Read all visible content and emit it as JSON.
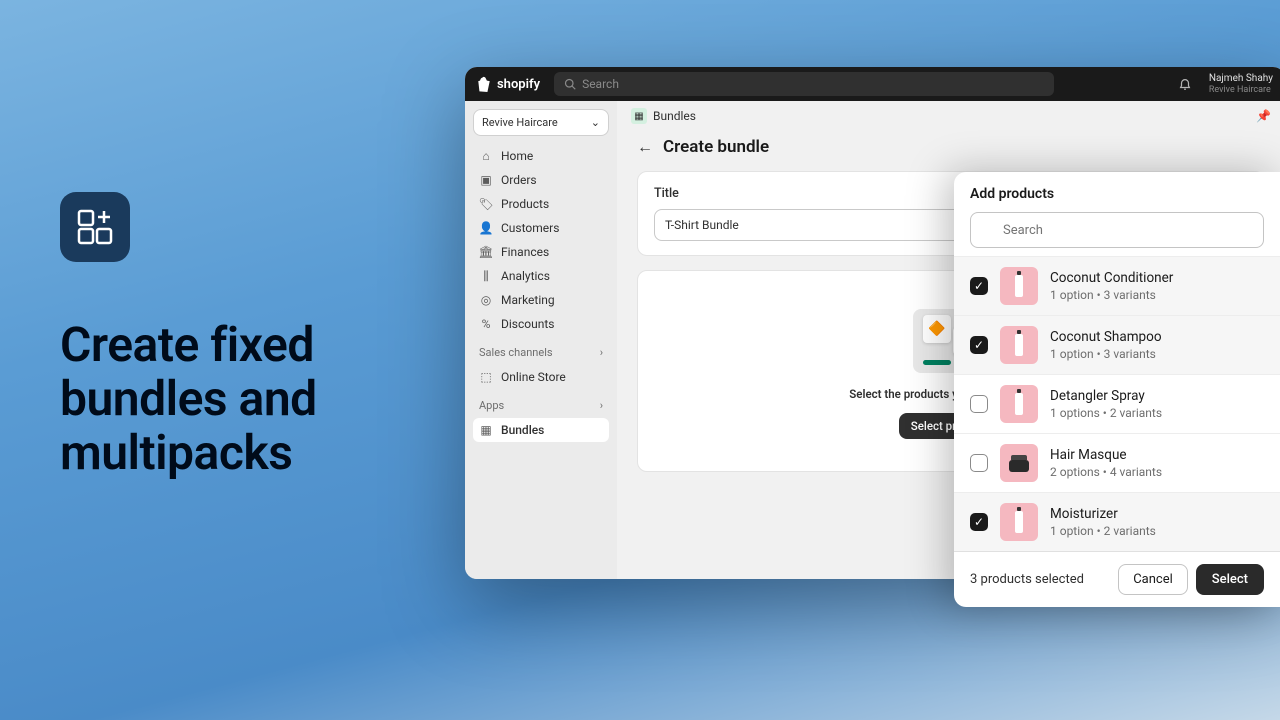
{
  "promo": {
    "headline_l1": "Create fixed",
    "headline_l2": "bundles and",
    "headline_l3": "multipacks"
  },
  "header": {
    "brand": "shopify",
    "search_placeholder": "Search",
    "user_name": "Najmeh Shahy",
    "user_store": "Revive Haircare"
  },
  "sidebar": {
    "store": "Revive Haircare",
    "nav": [
      {
        "icon": "home",
        "label": "Home"
      },
      {
        "icon": "orders",
        "label": "Orders"
      },
      {
        "icon": "products",
        "label": "Products"
      },
      {
        "icon": "customers",
        "label": "Customers"
      },
      {
        "icon": "finances",
        "label": "Finances"
      },
      {
        "icon": "analytics",
        "label": "Analytics"
      },
      {
        "icon": "marketing",
        "label": "Marketing"
      },
      {
        "icon": "discounts",
        "label": "Discounts"
      }
    ],
    "channels_label": "Sales channels",
    "channels": [
      {
        "label": "Online Store"
      }
    ],
    "apps_label": "Apps",
    "apps": [
      {
        "label": "Bundles"
      }
    ]
  },
  "crumb": {
    "label": "Bundles"
  },
  "page": {
    "title": "Create bundle",
    "title_field_label": "Title",
    "title_value": "T-Shirt Bundle",
    "empty_text": "Select the products you want to bundle.",
    "select_btn": "Select products"
  },
  "modal": {
    "title": "Add products",
    "search_placeholder": "Search",
    "products": [
      {
        "name": "Coconut Conditioner",
        "meta": "1 option • 3 variants",
        "checked": true,
        "thumb": "bottle"
      },
      {
        "name": "Coconut Shampoo",
        "meta": "1 option • 3 variants",
        "checked": true,
        "thumb": "bottle"
      },
      {
        "name": "Detangler Spray",
        "meta": "1 options • 2 variants",
        "checked": false,
        "thumb": "bottle"
      },
      {
        "name": "Hair Masque",
        "meta": "2 options • 4 variants",
        "checked": false,
        "thumb": "jar"
      },
      {
        "name": "Moisturizer",
        "meta": "1 option • 2 variants",
        "checked": true,
        "thumb": "bottle"
      }
    ],
    "selected_text": "3 products selected",
    "cancel": "Cancel",
    "select": "Select"
  },
  "icons": {
    "home": "⌂",
    "orders": "▭",
    "products": "◉",
    "customers": "👤",
    "finances": "🏛",
    "analytics": "📊",
    "marketing": "◎",
    "discounts": "%",
    "store": "🏬",
    "bundles": "▦"
  }
}
